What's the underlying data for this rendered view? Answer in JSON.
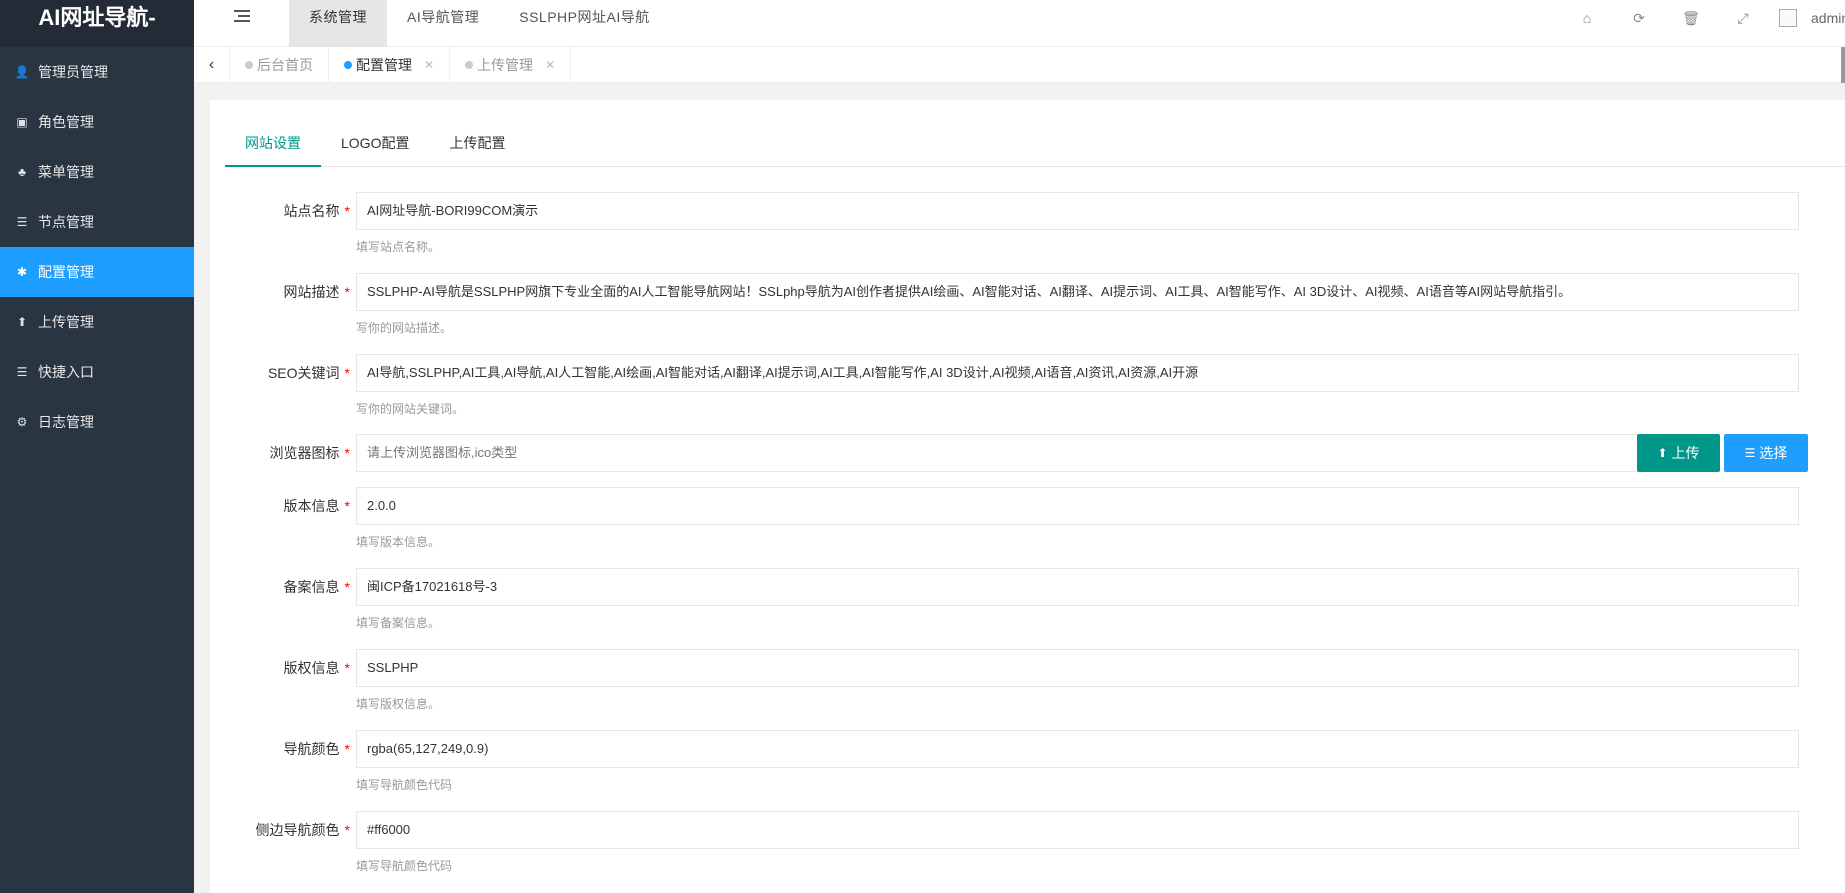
{
  "app": {
    "logo_text": "AI网址导航-"
  },
  "sidebar": {
    "items": [
      {
        "label": "管理员管理",
        "icon": "user-icon",
        "glyph": "👤"
      },
      {
        "label": "角色管理",
        "icon": "role-icon",
        "glyph": "▣"
      },
      {
        "label": "菜单管理",
        "icon": "tree-icon",
        "glyph": "♣"
      },
      {
        "label": "节点管理",
        "icon": "list-icon",
        "glyph": "☰"
      },
      {
        "label": "配置管理",
        "icon": "asterisk-icon",
        "glyph": "✱",
        "active": true
      },
      {
        "label": "上传管理",
        "icon": "arrow-up-icon",
        "glyph": "⬆"
      },
      {
        "label": "快捷入口",
        "icon": "list-icon",
        "glyph": "☰"
      },
      {
        "label": "日志管理",
        "icon": "log-icon",
        "glyph": "⚙"
      }
    ]
  },
  "header": {
    "tabs": [
      {
        "label": "系统管理",
        "active": true
      },
      {
        "label": "AI导航管理"
      },
      {
        "label": "SSLPHP网址AI导航"
      }
    ],
    "icons": [
      {
        "name": "home-icon",
        "glyph": "⌂"
      },
      {
        "name": "refresh-icon",
        "glyph": "⟳"
      },
      {
        "name": "trash-icon",
        "glyph": "🗑"
      },
      {
        "name": "fullscreen-icon",
        "glyph": "⤢"
      }
    ],
    "user": {
      "name": "admin"
    }
  },
  "page_tabs": [
    {
      "label": "后台首页",
      "closable": false
    },
    {
      "label": "配置管理",
      "closable": true,
      "active": true
    },
    {
      "label": "上传管理",
      "closable": true
    }
  ],
  "form": {
    "tabs": [
      {
        "label": "网站设置",
        "active": true
      },
      {
        "label": "LOGO配置"
      },
      {
        "label": "上传配置"
      }
    ],
    "fields": {
      "site_name": {
        "label": "站点名称",
        "value": "AI网址导航-BORI99COM演示",
        "help": "填写站点名称。"
      },
      "site_desc": {
        "label": "网站描述",
        "value": "SSLPHP-AI导航是SSLPHP网旗下专业全面的AI人工智能导航网站！SSLphp导航为AI创作者提供AI绘画、AI智能对话、AI翻译、AI提示词、AI工具、AI智能写作、AI 3D设计、AI视频、AI语音等AI网站导航指引。",
        "help": "写你的网站描述。"
      },
      "seo_keywords": {
        "label": "SEO关键词",
        "value": "AI导航,SSLPHP,AI工具,AI导航,AI人工智能,AI绘画,AI智能对话,AI翻译,AI提示词,AI工具,AI智能写作,AI 3D设计,AI视频,AI语音,AI资讯,AI资源,AI开源",
        "help": "写你的网站关键词。"
      },
      "favicon": {
        "label": "浏览器图标",
        "placeholder": "请上传浏览器图标,ico类型",
        "upload_label": "上传",
        "select_label": "选择"
      },
      "version": {
        "label": "版本信息",
        "value": "2.0.0",
        "help": "填写版本信息。"
      },
      "icp": {
        "label": "备案信息",
        "value": "闽ICP备17021618号-3",
        "help": "填写备案信息。"
      },
      "copyright": {
        "label": "版权信息",
        "value": "SSLPHP",
        "help": "填写版权信息。"
      },
      "nav_color": {
        "label": "导航颜色",
        "value": "rgba(65,127,249,0.9)",
        "help": "填写导航颜色代码"
      },
      "side_nav_color": {
        "label": "侧边导航颜色",
        "value": "#ff6000",
        "help": "填写导航颜色代码"
      }
    }
  },
  "colors": {
    "sidebar_bg": "#2a3542",
    "accent_blue": "#1e9fff",
    "accent_green": "#009688",
    "required_red": "#ff0000"
  }
}
